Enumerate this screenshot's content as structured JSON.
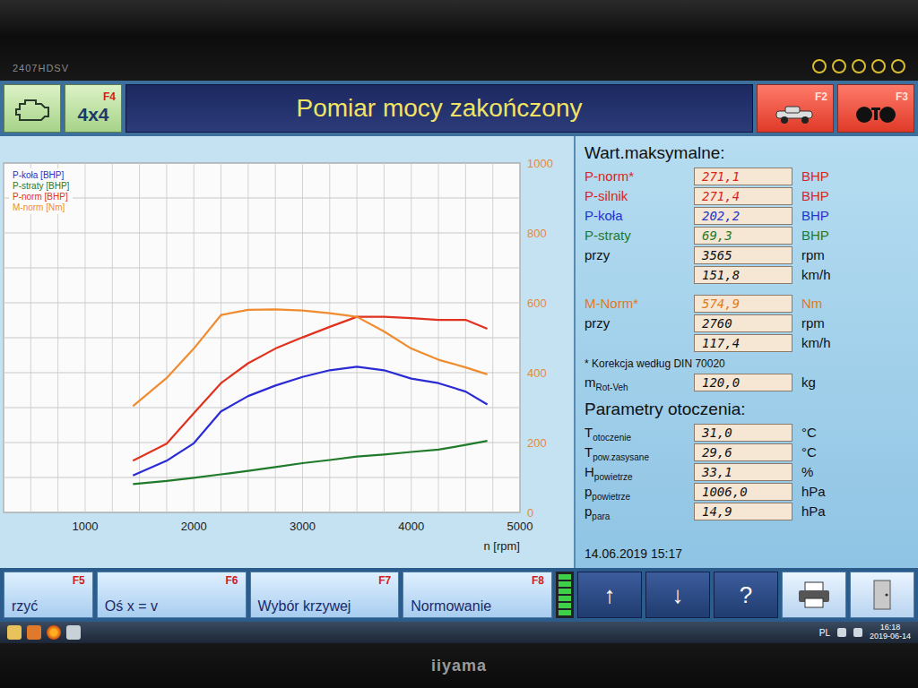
{
  "monitor": {
    "model": "2407HDSV",
    "brand": "iiyama"
  },
  "header": {
    "title": "Pomiar mocy zakończony",
    "mode_button": {
      "label": "4x4",
      "key": "F4"
    },
    "right_buttons": [
      {
        "key": "F2",
        "kind": "car"
      },
      {
        "key": "F3",
        "kind": "rollers"
      }
    ]
  },
  "chart": {
    "legend": [
      {
        "label": "P-koła [BHP]",
        "color": "#2b2bd6",
        "values": [
          106,
          148,
          198,
          289,
          333,
          363,
          388,
          407,
          417,
          407,
          383,
          370,
          346,
          309
        ]
      },
      {
        "label": "P-straty [BHP]",
        "color": "#1f7a2a",
        "values": [
          81,
          90,
          99,
          109,
          119,
          130,
          141,
          150,
          160,
          166,
          173,
          180,
          193,
          205
        ]
      },
      {
        "label": "P-norm [BHP]",
        "color": "#e0321e",
        "values": [
          148,
          197,
          284,
          370,
          427,
          469,
          501,
          531,
          560,
          560,
          556,
          551,
          551,
          526
        ]
      },
      {
        "label": "M-norm [Nm]",
        "color": "#f08c30",
        "values": [
          304,
          385,
          469,
          565,
          580,
          581,
          578,
          570,
          560,
          518,
          469,
          437,
          415,
          395
        ]
      }
    ],
    "rpm": [
      1440,
      1750,
      2000,
      2250,
      2500,
      2750,
      3000,
      3250,
      3500,
      3750,
      4000,
      4250,
      4500,
      4700
    ],
    "x_ticks": [
      "1000",
      "2000",
      "3000",
      "4000",
      "5000"
    ],
    "x_label": "n [rpm]",
    "y_ticks": [
      "0",
      "200",
      "400",
      "600",
      "800",
      "1000"
    ]
  },
  "max_values": {
    "title": "Wart.maksymalne:",
    "groups": [
      {
        "rows": [
          {
            "label": "P-norm*",
            "value": "271,1",
            "unit": "BHP",
            "color": "#d8261c"
          },
          {
            "label": "P-silnik",
            "value": "271,4",
            "unit": "BHP",
            "color": "#d8261c"
          },
          {
            "label": "P-koła",
            "value": "202,2",
            "unit": "BHP",
            "color": "#2233cc"
          },
          {
            "label": "P-straty",
            "value": "69,3",
            "unit": "BHP",
            "color": "#1f7a2a"
          },
          {
            "label": "przy",
            "value": "3565",
            "unit": "rpm",
            "color": "#111111"
          },
          {
            "label": "",
            "value": "151,8",
            "unit": "km/h",
            "color": "#111111"
          }
        ]
      },
      {
        "rows": [
          {
            "label": "M-Norm*",
            "value": "574,9",
            "unit": "Nm",
            "color": "#e07a1e"
          },
          {
            "label": "przy",
            "value": "2760",
            "unit": "rpm",
            "color": "#111111"
          },
          {
            "label": "",
            "value": "117,4",
            "unit": "km/h",
            "color": "#111111"
          }
        ]
      }
    ]
  },
  "note": "* Korekcja według DIN 70020",
  "mass": {
    "symbol": "m",
    "sub": "Rot-Veh",
    "value": "120,0",
    "unit": "kg"
  },
  "ambient": {
    "title": "Parametry otoczenia:",
    "rows": [
      {
        "symbol": "T",
        "sub": "otoczenie",
        "value": "31,0",
        "unit": "°C"
      },
      {
        "symbol": "T",
        "sub": "pow.zasysane",
        "value": "29,6",
        "unit": "°C"
      },
      {
        "symbol": "H",
        "sub": "powietrze",
        "value": "33,1",
        "unit": "%"
      },
      {
        "symbol": "p",
        "sub": "powietrze",
        "value": "1006,0",
        "unit": "hPa"
      },
      {
        "symbol": "p",
        "sub": "para",
        "value": "14,9",
        "unit": "hPa"
      }
    ]
  },
  "timestamp": "14.06.2019 15:17",
  "function_keys": [
    {
      "label": "rzyć",
      "key": "F5"
    },
    {
      "label": "Oś x = v",
      "key": "F6"
    },
    {
      "label": "Wybór krzywej",
      "key": "F7"
    },
    {
      "label": "Normowanie",
      "key": "F8"
    }
  ],
  "indicator": {
    "level": 1
  },
  "nav_buttons": [
    "↑",
    "↓",
    "?"
  ],
  "taskbar": {
    "language": "PL",
    "time": "16:18",
    "date": "2019-06-14"
  }
}
